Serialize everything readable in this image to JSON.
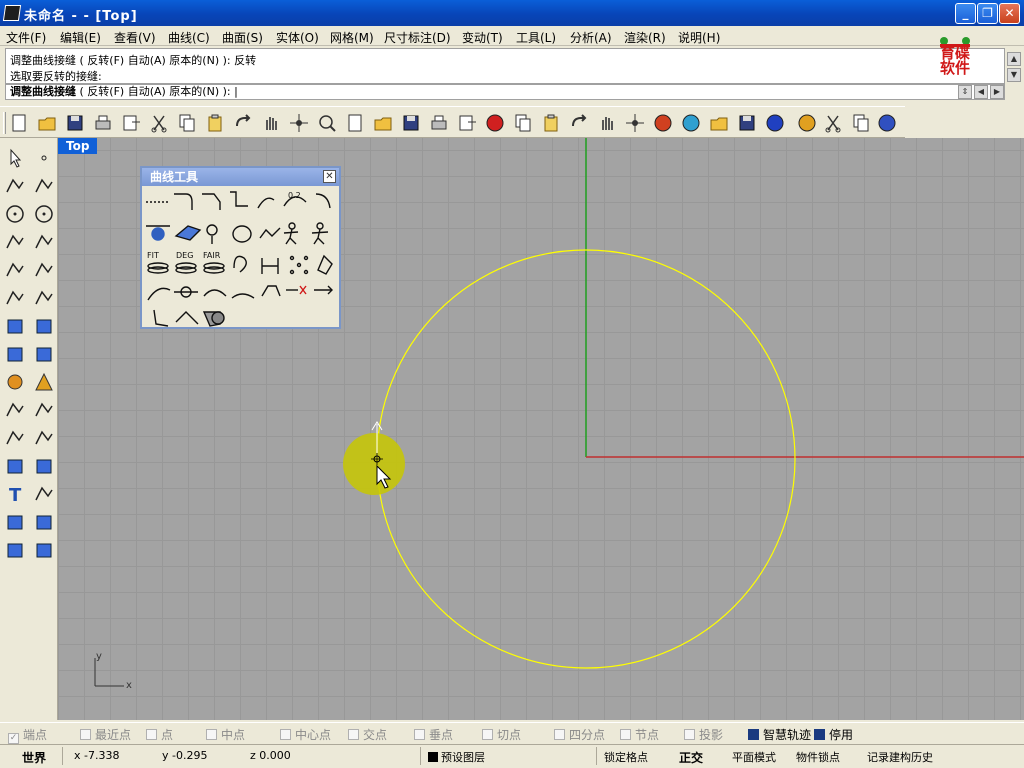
{
  "window": {
    "title": "未命名 - - [Top]",
    "minimize": "_",
    "maximize": "❐",
    "close": "✕"
  },
  "menu": [
    "文件(F)",
    "编辑(E)",
    "查看(V)",
    "曲线(C)",
    "曲面(S)",
    "实体(O)",
    "网格(M)",
    "尺寸标注(D)",
    "变动(T)",
    "工具(L)",
    "分析(A)",
    "渲染(R)",
    "说明(H)"
  ],
  "command": {
    "history_line1": "调整曲线接缝 ( 反转(F)  自动(A)  原本的(N) ): 反转",
    "history_line2": "选取要反转的接缝:",
    "prompt_name": "调整曲线接缝",
    "prompt_options": " ( 反转(F)  自动(A)  原本的(N) ): |"
  },
  "logo": {
    "text": "育碟软件"
  },
  "toolbar": {
    "icons": [
      "new-file-icon",
      "open-folder-icon",
      "save-icon",
      "print-icon",
      "import-icon",
      "cut-icon",
      "copy-icon",
      "paste-icon",
      "undo-icon",
      "pan-hand-icon",
      "rotate-view-icon",
      "zoom-icon",
      "zoom-window-icon",
      "zoom-extents-icon",
      "zoom-selected-icon",
      "undo-view-icon",
      "four-viewports-icon",
      "car-render-icon",
      "plane-icon",
      "circle-target-icon",
      "osnap-icon",
      "light-bulb-icon",
      "lock-icon",
      "layer-icon",
      "color-wheel-icon",
      "sphere-wire-icon",
      "sphere-mesh-icon",
      "sphere-shaded-icon",
      "cone-icon",
      "gear-options-icon",
      "crop-icon",
      "help-icon"
    ]
  },
  "left_tools": {
    "icons": [
      "select-arrow-icon",
      "point-icon",
      "polyline-icon",
      "curve-icon",
      "circle-icon",
      "ellipse-icon",
      "arc-icon",
      "rectangle-icon",
      "polygon-icon",
      "fillet-curve-icon",
      "surface-icon",
      "loft-icon",
      "box-icon",
      "spheres-icon",
      "cylinder-icon",
      "mesh-plane-icon",
      "gear-transform-icon",
      "explode-icon",
      "trim-icon",
      "split-icon",
      "boolean-icon",
      "group-icon",
      "offset-icon",
      "extend-icon",
      "text-icon",
      "move-icon",
      "array-icon",
      "scale-icon",
      "block-icon",
      "dimension-icon"
    ]
  },
  "viewport": {
    "tab_label": "Top",
    "axis_x_label": "x",
    "axis_y_label": "y"
  },
  "curve_panel": {
    "title": "曲线工具",
    "close": "✕",
    "labels": {
      "fit": "FIT",
      "deg": "DEG",
      "fair": "FAIR",
      "deg_num": "0.2"
    }
  },
  "osnap": [
    {
      "label": "端点",
      "checked": true,
      "active": false
    },
    {
      "label": "最近点",
      "checked": false,
      "active": false
    },
    {
      "label": "点",
      "checked": false,
      "active": false
    },
    {
      "label": "中点",
      "checked": false,
      "active": false
    },
    {
      "label": "中心点",
      "checked": false,
      "active": false
    },
    {
      "label": "交点",
      "checked": false,
      "active": false
    },
    {
      "label": "垂点",
      "checked": false,
      "active": false
    },
    {
      "label": "切点",
      "checked": false,
      "active": false
    },
    {
      "label": "四分点",
      "checked": false,
      "active": false
    },
    {
      "label": "节点",
      "checked": false,
      "active": false
    },
    {
      "label": "投影",
      "checked": false,
      "active": false
    },
    {
      "label": "智慧轨迹",
      "checked": true,
      "active": false
    },
    {
      "label": "停用",
      "checked": true,
      "active": true
    }
  ],
  "status": {
    "world": "世界",
    "x": "x -7.338",
    "y": "y -0.295",
    "z": "z 0.000",
    "layer": "预设图层",
    "snap": "锁定格点",
    "ortho": "正交",
    "planar": "平面模式",
    "osnap": "物件锁点",
    "history": "记录建构历史"
  },
  "colors": {
    "curve": "#ffff00",
    "x_axis": "#c03030",
    "y_axis": "#20a020",
    "highlight": "#c8c800"
  }
}
